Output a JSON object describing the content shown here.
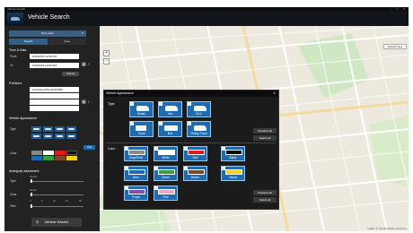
{
  "window": {
    "title": "Vehicle Search",
    "controls": "– ☐ ✕"
  },
  "header": {
    "title": "Vehicle Search"
  },
  "sidebar": {
    "new_case": "New Case",
    "tabs": [
      {
        "label": "Search"
      },
      {
        "label": "Case"
      }
    ],
    "time_date": {
      "heading": "Time & Date",
      "from_label": "From",
      "from_value": "9/15/2018 12:00 PM",
      "to_label": "To",
      "to_value": "9/16/2018 12:00 PM",
      "button": "Submit"
    },
    "positions": {
      "heading": "Positions",
      "items": [
        "Amersfoort/South/SMS50",
        "",
        "",
        ""
      ]
    },
    "vehicle_appearance": {
      "heading": "Vehicle Appearance",
      "type_label": "Type",
      "color_label": "Color",
      "tag": "Edit"
    },
    "ambiguity": {
      "heading": "Ambiguity adjustment",
      "type_label": "Type",
      "color_label": "Color",
      "time_label": "Time",
      "slider_sub": "Narrow",
      "time_ticks": [
        "0",
        "5",
        "10",
        "15",
        "30"
      ]
    },
    "search_button": "Vehicle Search"
  },
  "map": {
    "default_view": "Default View",
    "attribution": "Leaflet | © OpenStreetMap contributors"
  },
  "dialog": {
    "title": "Vehicle Appearance",
    "type_label": "Type",
    "types": [
      "Sedan",
      "Van",
      "SUV",
      "Truck",
      "Bus",
      "Pickup Truck"
    ],
    "color_label": "Color",
    "colors": [
      {
        "name": "Gray/Silver",
        "swatch": "#8a8a8a"
      },
      {
        "name": "White",
        "swatch": "#ffffff"
      },
      {
        "name": "Red",
        "swatch": "#e01b1b"
      },
      {
        "name": "Black",
        "swatch": "#0a0a0a"
      },
      {
        "name": "Blue",
        "swatch": "#1f6bb0"
      },
      {
        "name": "Green",
        "swatch": "#36a13a"
      },
      {
        "name": "Brown",
        "swatch": "#7a4a26"
      },
      {
        "name": "Yellow",
        "swatch": "#f2d21b"
      },
      {
        "name": "Purple",
        "swatch": "#8a4bb0"
      },
      {
        "name": "Pink",
        "swatch": "#f0a4c6"
      }
    ],
    "deselect_all": "Deselect all",
    "select_all": "Select all"
  },
  "colors": {
    "accent": "#2f5f8c",
    "tile": "#1f6bb0",
    "sidebar_swatches": [
      "#888888",
      "#ffffff",
      "#e01b1b",
      "#111111",
      "#1f6bb0",
      "#36a13a",
      "#7a4a26",
      "#f2d21b"
    ]
  }
}
